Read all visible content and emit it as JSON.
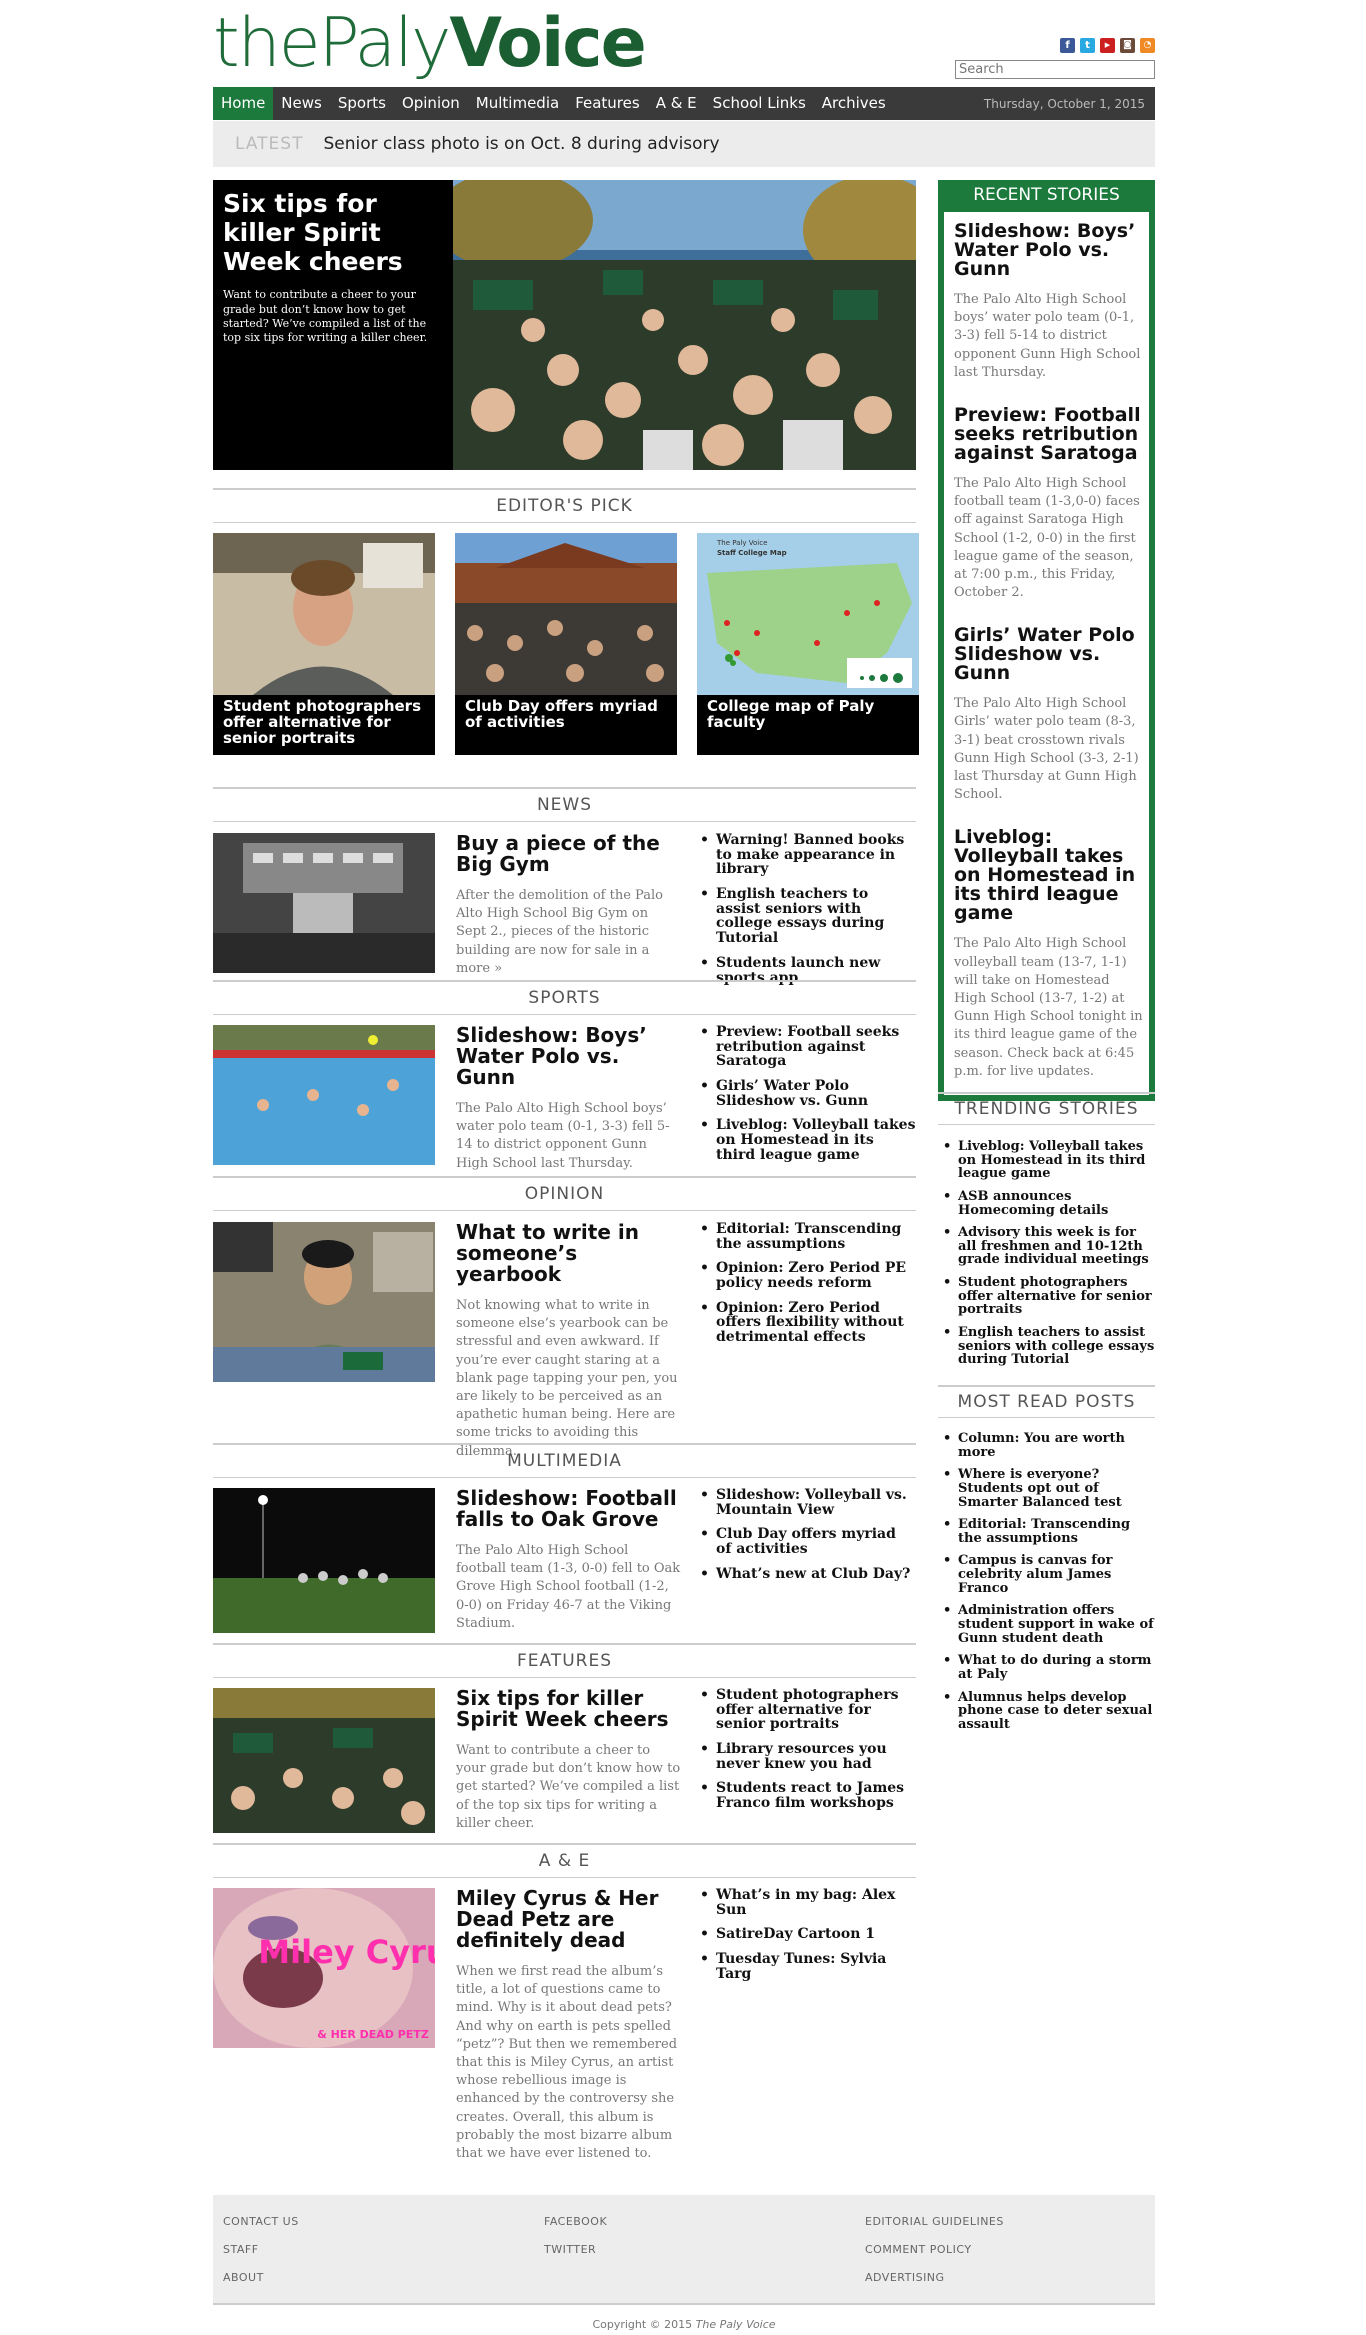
{
  "header": {
    "logo_the": "the",
    "logo_paly": "Paly",
    "logo_voice": "Voice",
    "search_placeholder": "Search",
    "social": [
      "f",
      "t",
      "yt",
      "ig",
      "rss"
    ]
  },
  "nav": {
    "items": [
      "Home",
      "News",
      "Sports",
      "Opinion",
      "Multimedia",
      "Features",
      "A & E",
      "School Links",
      "Archives"
    ],
    "date": "Thursday, October 1, 2015"
  },
  "latest": {
    "label": "LATEST",
    "text": "Senior class photo is on Oct. 8 during advisory"
  },
  "feature": {
    "title": "Six tips for killer Spirit Week cheers",
    "blurb": "Want to contribute a cheer to your grade but don’t know how to get started? We’ve compiled a list of the top six tips for writing a killer cheer."
  },
  "editors_pick": {
    "heading": "EDITOR'S PICK",
    "items": [
      {
        "label": "Student photographers offer alternative for senior portraits"
      },
      {
        "label": "Club Day offers myriad of activities"
      },
      {
        "label": "College map of Paly faculty"
      }
    ],
    "map_title": "The Paly Voice",
    "map_subtitle": "Staff College Map"
  },
  "sections": [
    {
      "heading": "NEWS",
      "title": "Buy a piece of the Big Gym",
      "blurb": "After the demolition of the Palo Alto High School Big Gym on Sept 2., pieces of the historic building are now for sale in a more »",
      "links": [
        "Warning! Banned books to make appearance in library",
        "English teachers to assist seniors with college essays during Tutorial",
        "Students launch new sports app"
      ]
    },
    {
      "heading": "SPORTS",
      "title": "Slideshow: Boys’ Water Polo vs. Gunn",
      "blurb": "The Palo Alto High School boys’ water polo team (0-1, 3-3) fell 5-14 to district opponent Gunn High School last Thursday.",
      "links": [
        "Preview: Football seeks retribution against Saratoga",
        "Girls’ Water Polo Slideshow vs. Gunn",
        "Liveblog: Volleyball takes on Homestead in its third league game"
      ]
    },
    {
      "heading": "OPINION",
      "title": "What to write in someone’s yearbook",
      "blurb": "Not knowing what to write in someone else’s yearbook can be stressful and even awkward. If you’re ever caught staring at a blank page tapping your pen, you are likely to be perceived as an apathetic human being. Here are some tricks to avoiding this dilemma.",
      "links": [
        "Editorial: Transcending the assumptions",
        "Opinion: Zero Period PE policy needs reform",
        "Opinion: Zero Period offers flexibility without detrimental effects"
      ]
    },
    {
      "heading": "MULTIMEDIA",
      "title": "Slideshow: Football falls to Oak Grove",
      "blurb": "The Palo Alto High School football team (1-3, 0-0) fell to Oak Grove High School football (1-2, 0-0) on Friday 46-7 at the Viking Stadium.",
      "links": [
        "Slideshow: Volleyball vs. Mountain View",
        "Club Day offers myriad of activities",
        "What’s new at Club Day?"
      ]
    },
    {
      "heading": "FEATURES",
      "title": "Six tips for killer Spirit Week cheers",
      "blurb": "Want to contribute a cheer to your grade but don’t know how to get started? We’ve compiled a list of the top six tips for writing a killer cheer.",
      "links": [
        "Student photographers offer alternative for senior portraits",
        "Library resources you never knew you had",
        "Students react to James Franco film workshops"
      ]
    },
    {
      "heading": "A & E",
      "title": "Miley Cyrus & Her Dead Petz are definitely dead",
      "blurb": "When we first read the album’s title, a lot of questions came to mind. Why is it about dead pets? And why on earth is pets spelled “petz”? But then we remembered that this is Miley Cyrus, an artist whose rebellious image is enhanced by the controversy she creates. Overall, this album is probably the most bizarre album that we have ever listened to.",
      "links": [
        "What’s in my bag: Alex Sun",
        "SatireDay Cartoon 1",
        "Tuesday Tunes: Sylvia Targ"
      ],
      "album_art_text": "Miley Cyrus",
      "album_art_sub": "& HER DEAD PETZ"
    }
  ],
  "recent": {
    "heading": "RECENT STORIES",
    "items": [
      {
        "title": "Slideshow: Boys’ Water Polo vs. Gunn",
        "blurb": "The Palo Alto High School boys’ water polo team (0-1, 3-3) fell 5-14 to district opponent Gunn High School last Thursday."
      },
      {
        "title": "Preview: Football seeks retribution against Saratoga",
        "blurb": "The Palo Alto High School football team (1-3,0-0) faces off against Saratoga High School (1-2, 0-0) in the first league game of the season, at 7:00 p.m., this Friday, October 2."
      },
      {
        "title": "Girls’ Water Polo Slideshow vs. Gunn",
        "blurb": "The Palo Alto High School Girls’ water polo team (8-3, 3-1) beat crosstown rivals Gunn High School (3-3, 2-1) last Thursday at Gunn High School."
      },
      {
        "title": "Liveblog: Volleyball takes on Homestead in its third league game",
        "blurb": "The Palo Alto High School volleyball team (13-7, 1-1) will take on Homestead High School (13-7, 1-2) at Gunn High School tonight in its third league game of the season. Check back at 6:45 p.m. for live updates."
      }
    ]
  },
  "trending": {
    "heading": "TRENDING STORIES",
    "items": [
      "Liveblog: Volleyball takes on Homestead in its third league game",
      "ASB announces Homecoming details",
      "Advisory this week is for all freshmen and 10-12th grade individual meetings",
      "Student photographers offer alternative for senior portraits",
      "English teachers to assist seniors with college essays during Tutorial"
    ]
  },
  "most_read": {
    "heading": "MOST READ POSTS",
    "items": [
      "Column: You are worth more",
      "Where is everyone? Students opt out of Smarter Balanced test",
      "Editorial: Transcending the assumptions",
      "Campus is canvas for celebrity alum James Franco",
      "Administration offers student support in wake of Gunn student death",
      "What to do during a storm at Paly",
      "Alumnus helps develop phone case to deter sexual assault"
    ]
  },
  "footer": {
    "col1": [
      "CONTACT US",
      "STAFF",
      "ABOUT"
    ],
    "col2": [
      "FACEBOOK",
      "TWITTER"
    ],
    "col3": [
      "EDITORIAL GUIDELINES",
      "COMMENT POLICY",
      "ADVERTISING"
    ],
    "copyright_prefix": "Copyright © 2015 ",
    "copyright_name": "The Paly Voice"
  },
  "colors": {
    "brand_green": "#1b7a3c",
    "nav_bg": "#3a3a3a"
  }
}
